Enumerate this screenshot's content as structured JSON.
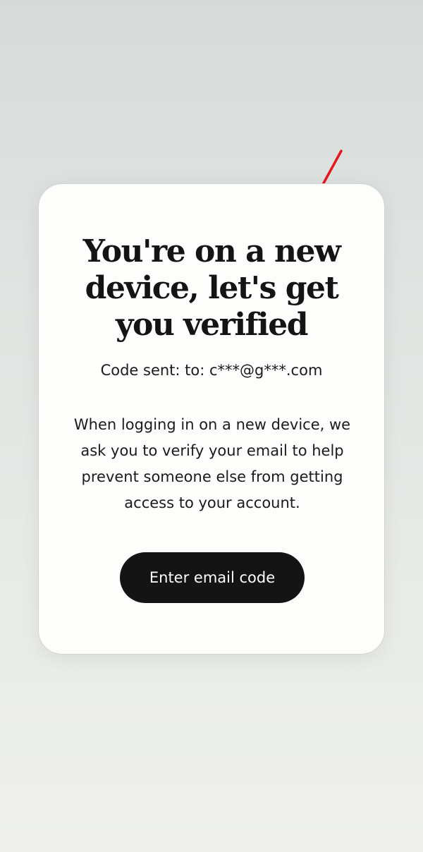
{
  "dialog": {
    "title": "You're on a new device, let's get you verified",
    "code_sent": "Code sent: to: c***@g***.com",
    "body": "When logging in on a new device, we ask you to verify your email to help prevent someone else from getting access to your account.",
    "cta_label": "Enter email code"
  },
  "annotation": {
    "icon": "arrow-icon",
    "color": "#e8141e"
  },
  "colors": {
    "button_bg": "#141414",
    "button_text": "#ffffff",
    "card_bg": "#fdfdfb"
  }
}
